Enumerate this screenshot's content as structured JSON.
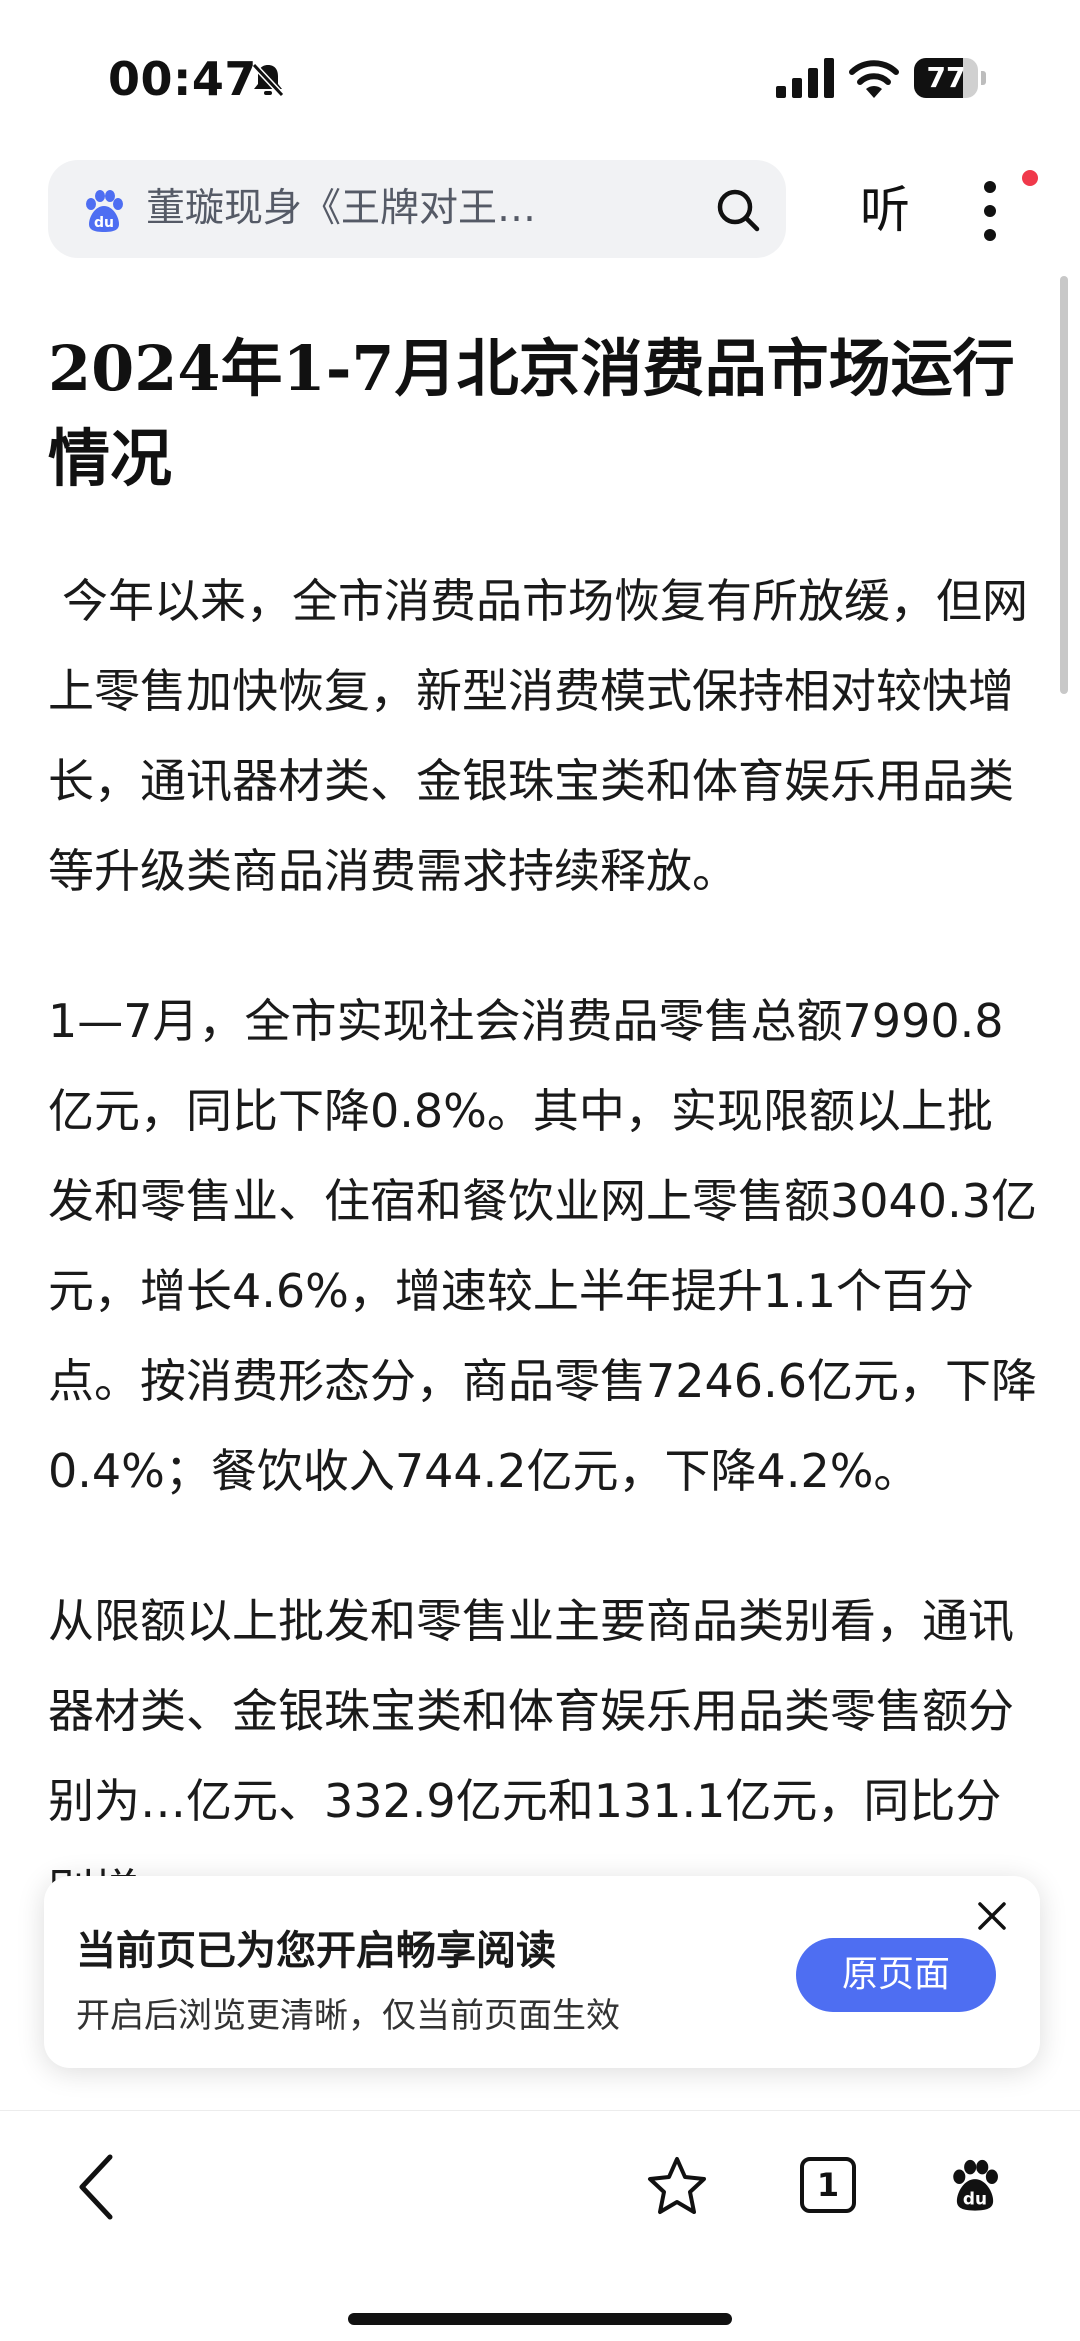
{
  "status_bar": {
    "time": "00:47",
    "battery": "77",
    "battery_level": 0.77
  },
  "search": {
    "text": "董璇现身《王牌对王…"
  },
  "header": {
    "listen_label": "听"
  },
  "article": {
    "title": "2024年1-7月北京消费品市场运行情况",
    "paragraphs": [
      "今年以来，全市消费品市场恢复有所放缓，但网上零售加快恢复，新型消费模式保持相对较快增长，通讯器材类、金银珠宝类和体育娱乐用品类等升级类商品消费需求持续释放。",
      "1—7月，全市实现社会消费品零售总额7990.8亿元，同比下降0.8%。其中，实现限额以上批发和零售业、住宿和餐饮业网上零售额3040.3亿元，增长4.6%，增速较上半年提升1.1个百分点。按消费形态分，商品零售7246.6亿元，下降0.4%；餐饮收入744.2亿元，下降4.2%。",
      "从限额以上批发和零售业主要商品类别看，通讯器材类、金银珠宝类和体育娱乐用品类零售额分别为…亿元、332.9亿元和131.1亿元，同比分别增"
    ]
  },
  "banner": {
    "title": "当前页已为您开启畅享阅读",
    "subtitle": "开启后浏览更清晰，仅当前页面生效",
    "button_label": "原页面"
  },
  "toolbar": {
    "tab_count": "1"
  },
  "colors": {
    "accent": "#4e6ef2",
    "notification_dot": "#f0394b",
    "search_bg": "#f1f2f4"
  },
  "icons": [
    "mute-bell-icon",
    "signal-icon",
    "wifi-icon",
    "battery-icon",
    "baidu-logo-icon",
    "search-icon",
    "more-icon",
    "close-icon",
    "back-icon",
    "star-icon",
    "tabs-icon",
    "baidu-paw-icon"
  ]
}
